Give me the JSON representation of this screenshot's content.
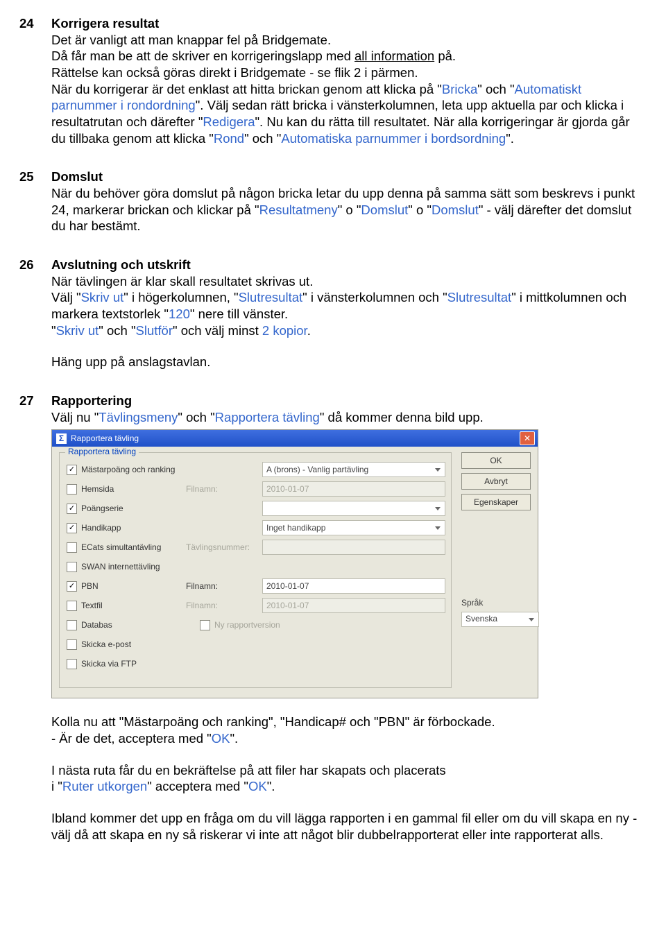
{
  "s24": {
    "num": "24",
    "title": "Korrigera resultat",
    "p1a": "Det är vanligt att man knappar fel på Bridgemate.",
    "p1b_a": "Då får man be att de skriver en korrigeringslapp med ",
    "p1b_u": "all information",
    "p1b_c": " på.",
    "p2": "Rättelse kan också göras direkt i Bridgemate - se flik 2 i pärmen.",
    "p3a": "När du korrigerar är det enklast att hitta brickan genom att klicka på \"",
    "p3_bricka": "Bricka",
    "p3b": "\" och \"",
    "p3_auto": "Automatiskt parnummer i rondordning",
    "p3c": "\". Välj sedan rätt bricka i vänsterkolumnen, leta upp aktuella par och klicka i resultatrutan och därefter \"",
    "p3_red": "Redigera",
    "p3d": "\". Nu kan du rätta till resultatet. När alla korrigeringar är gjorda går du tillbaka genom att klicka \"",
    "p3_rond": "Rond",
    "p3e": "\" och \"",
    "p3_autobord": "Automatiska parnummer i bordsordning",
    "p3f": "\"."
  },
  "s25": {
    "num": "25",
    "title": "Domslut",
    "p1a": "När du behöver göra domslut på någon bricka letar du upp denna på samma sätt som beskrevs i punkt 24, markerar brickan och klickar på \"",
    "p1_res": "Resultatmeny",
    "p1b": "\" o \"",
    "p1_dom1": "Domslut",
    "p1c": "\" o \"",
    "p1_dom2": "Domslut",
    "p1d": "\" - välj därefter det domslut du har bestämt."
  },
  "s26": {
    "num": "26",
    "title": "Avslutning och utskrift",
    "p1": "När tävlingen är klar skall resultatet skrivas ut.",
    "p2a": "Välj \"",
    "p2_skriv": "Skriv ut",
    "p2b": "\" i högerkolumnen, \"",
    "p2_slut1": "Slutresultat",
    "p2c": "\" i vänsterkolumnen och \"",
    "p2_slut2": "Slutresultat",
    "p2d": "\" i mittkolumnen och markera textstorlek \"",
    "p2_120": "120",
    "p2e": "\" nere till vänster.",
    "p3a": "\"",
    "p3_skriv": "Skriv ut",
    "p3b": "\" och \"",
    "p3_slutfor": "Slutför",
    "p3c": "\" och välj minst ",
    "p3_two": "2 kopior",
    "p3d": ".",
    "p4": "Häng upp på anslagstavlan."
  },
  "s27": {
    "num": "27",
    "title": "Rapportering",
    "p1a": "Välj nu \"",
    "p1_tav": "Tävlingsmeny",
    "p1b": "\" och \"",
    "p1_rap": "Rapportera tävling",
    "p1c": "\" då kommer denna bild upp.",
    "dialog": {
      "title": "Rapportera tävling",
      "legend": "Rapportera tävling",
      "buttons": {
        "ok": "OK",
        "cancel": "Avbryt",
        "props": "Egenskaper"
      },
      "lang_label": "Språk",
      "lang_value": "Svenska",
      "left": [
        {
          "label": "Mästarpoäng och ranking",
          "checked": true
        },
        {
          "label": "Hemsida",
          "checked": false
        },
        {
          "label": "Poängserie",
          "checked": true
        },
        {
          "label": "Handikapp",
          "checked": true
        },
        {
          "label": "ECats simultantävling",
          "checked": false
        },
        {
          "label": "SWAN internettävling",
          "checked": false
        },
        {
          "label": "PBN",
          "checked": true
        },
        {
          "label": "Textfil",
          "checked": false
        },
        {
          "label": "Databas",
          "checked": false
        },
        {
          "label": "Skicka e-post",
          "checked": false
        },
        {
          "label": "Skicka via FTP",
          "checked": false
        }
      ],
      "right": {
        "r1": {
          "label": "",
          "value": "A (brons) - Vanlig partävling",
          "dd": true,
          "labelActive": true
        },
        "r2": {
          "label": "Filnamn:",
          "value": "2010-01-07"
        },
        "r3": {
          "label": "",
          "value": "",
          "dd": true
        },
        "r4": {
          "label": "",
          "value": "Inget handikapp",
          "dd": true
        },
        "r5": {
          "label": "Tävlingsnummer:",
          "value": ""
        },
        "r6": {
          "label": "",
          "value": ""
        },
        "r7": {
          "label": "Filnamn:",
          "value": "2010-01-07",
          "labelActive": true,
          "inputActive": true
        },
        "r8": {
          "label": "Filnamn:",
          "value": "2010-01-07"
        },
        "r9cb": {
          "label": "Ny rapportversion"
        }
      }
    },
    "after_a": "Kolla nu att \"Mästarpoäng och ranking\", \"Handicap# och \"PBN\" är förbockade.",
    "after_b_a": "- Är de det, acceptera med \"",
    "after_b_ok": "OK",
    "after_b_b": "\".",
    "after_c": "I nästa ruta får du en bekräftelse på att filer har skapats och placerats",
    "after_d_a": "i \"",
    "after_d_r": "Ruter utkorgen",
    "after_d_b": "\" acceptera med \"",
    "after_d_ok": "OK",
    "after_d_c": "\".",
    "after_e": "Ibland kommer det upp en fråga om du vill lägga rapporten i en gammal fil eller om du vill skapa en ny - välj då att skapa en ny så riskerar vi inte att något blir dubbelrapporterat eller inte rapporterat alls."
  }
}
